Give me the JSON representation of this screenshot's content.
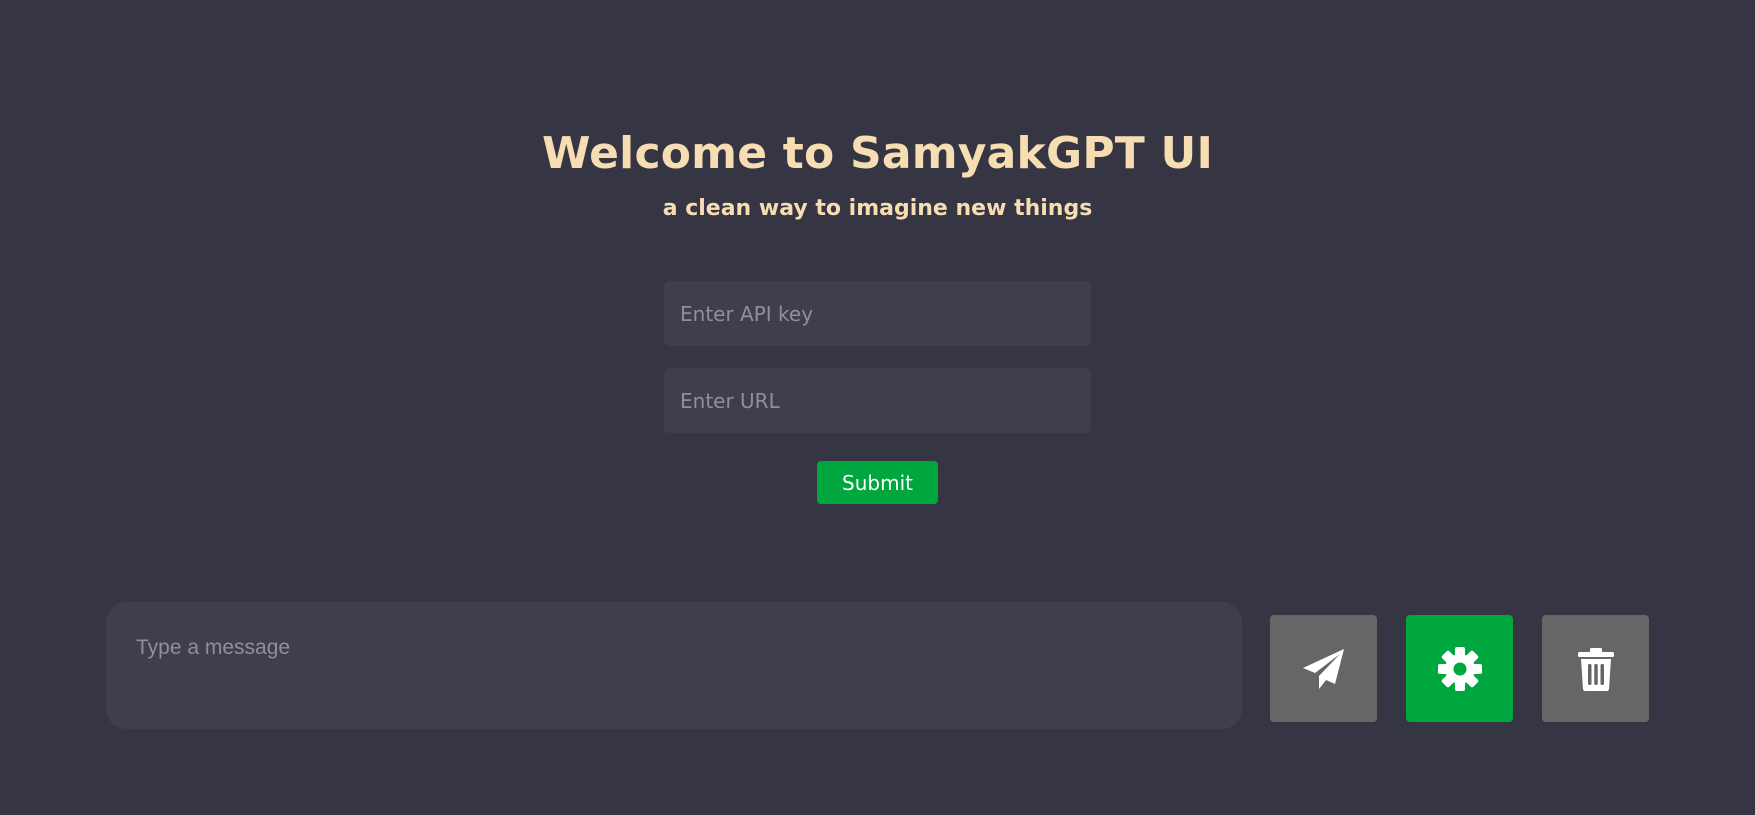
{
  "header": {
    "title": "Welcome to SamyakGPT UI",
    "subtitle": "a clean way to imagine new things"
  },
  "setup_form": {
    "api_key_placeholder": "Enter API key",
    "api_key_value": "",
    "url_placeholder": "Enter URL",
    "url_value": "",
    "submit_label": "Submit"
  },
  "composer": {
    "placeholder": "Type a message",
    "value": ""
  },
  "actions": [
    {
      "name": "send",
      "icon": "paper-plane-icon",
      "color": "#666666"
    },
    {
      "name": "settings",
      "icon": "gear-icon",
      "color": "#00a63e"
    },
    {
      "name": "delete",
      "icon": "trash-icon",
      "color": "#666666"
    }
  ],
  "colors": {
    "background": "#353543",
    "panel": "#3e3e4c",
    "accent": "#00a63e",
    "heading": "#f6deb2",
    "neutral_button": "#666666"
  }
}
